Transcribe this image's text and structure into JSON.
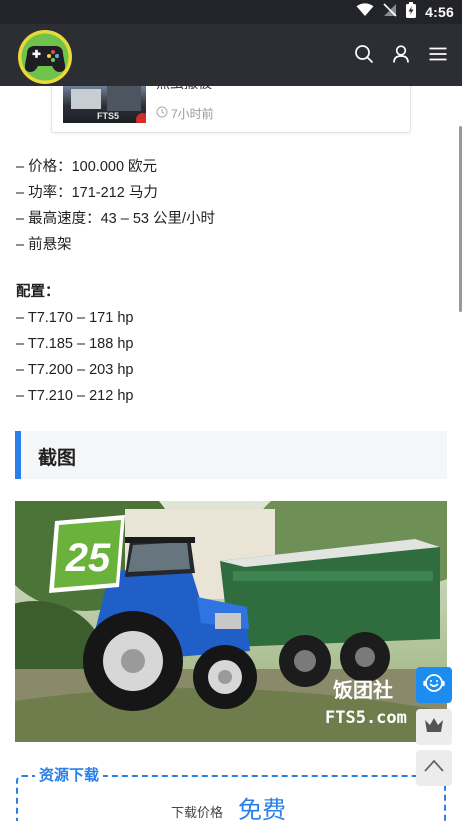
{
  "status_bar": {
    "time": "4:56"
  },
  "related_post": {
    "title": "焦虫撒被",
    "time": "7小时前"
  },
  "specs": [
    "– 价格：100.000 欧元",
    "– 功率：171-212 马力",
    "– 最高速度：43 – 53 公里/小时",
    "– 前悬架"
  ],
  "config": {
    "heading": "配置：",
    "items": [
      "– T7.170 – 171 hp",
      "– T7.185 – 188 hp",
      "– T7.200 – 203 hp",
      "– T7.210 – 212 hp"
    ]
  },
  "screenshots_heading": "截图",
  "screenshot": {
    "badge_number": "25",
    "watermark_cn": "饭团社",
    "watermark_en": "FTS5.com"
  },
  "download": {
    "title": "资源下载",
    "price_label": "下载价格",
    "price_value": "免费"
  },
  "colors": {
    "accent": "#2a7fe8",
    "header_bg": "#2c2e34",
    "status_bg": "#232429"
  },
  "icons": {
    "header": [
      "search-icon",
      "user-icon",
      "menu-icon"
    ],
    "float": [
      "customer-service-icon",
      "crown-icon",
      "back-to-top-icon"
    ]
  }
}
